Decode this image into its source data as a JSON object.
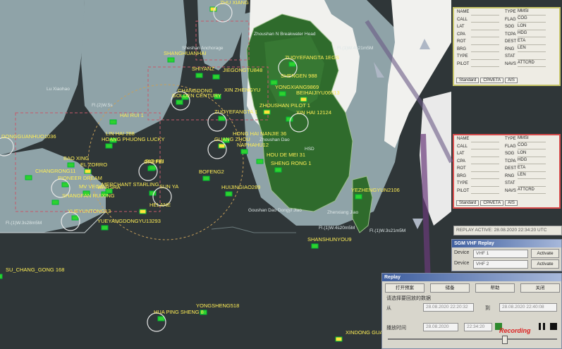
{
  "ships": [
    "ZHU XIANG",
    "SHANGHUANHAI",
    "SHIYANZ",
    "JIEGONGTU848",
    "CHANGDONG",
    "GOLDEN CENTURY",
    "XIN ZHENGYU",
    "ZHOUSHAN PILOT 1",
    "ZUOYEFANGTA 1",
    "HAI RUI 1",
    "LIN HAI 288",
    "HOANG PHUONG LUCKY",
    "DONGGUANHUO1036",
    "BAO XING",
    "EL ZORRO",
    "CHANGRONG11",
    "PIONEER DREAM",
    "MV VEGA",
    "SHANGFAN RUIXING",
    "WARSHA",
    "YUEYUNTONG13",
    "HELANE",
    "YUEYANGDONGYU13293",
    "GREFEI",
    "SUN YA",
    "BOFENG2",
    "HUIJINGIAO289",
    "HONG HAI NANJIE 36",
    "GUANG ZHOU",
    "NAPHAHU12",
    "HOU DE MEI 31",
    "SHENG RONG 1",
    "ZUOYEFANGTA 1EGS",
    "SHENGEN 988",
    "YONGXIANG9869",
    "BEIHAIJIYU06013",
    "XIN HAI 12124",
    "SHANSHUNYOU9",
    "YEZHENGYUN2106",
    "SU_CHANG_GONG 168",
    "HUA PING SHENG 8",
    "YONGSHENG518",
    "XINDONG GUAN",
    "MERCHANT STARLING",
    "PIG FEI"
  ],
  "places": [
    "Zhoushan N Breakwater Head",
    "Sheshan Anchorage",
    "Zhoushan Dao",
    "Goushan Dao Dongyi Jiao",
    "Zhenxiang Jiao",
    "HSD",
    "Lu Xiaohao"
  ],
  "positions": [
    "Fl.(2)W.5s",
    "Fl.(1)W.3s28m5M",
    "Fl.(1)W.4s20m5M",
    "Fl.(1)W.3s21m5M",
    "Fl.(1)W.4s21m5M"
  ],
  "info_panel_top": {
    "rows": [
      [
        "NAME",
        "TYPE",
        "MMSI"
      ],
      [
        "CALL",
        "FLAG",
        "COG"
      ],
      [
        "LAT",
        "SOG",
        "LON"
      ],
      [
        "CPA",
        "TCPA",
        "HDG"
      ],
      [
        "ROT",
        "DEST",
        "ETA"
      ],
      [
        "BRG",
        "RNG",
        "LEN"
      ],
      [
        "TYPE",
        "STAT",
        ""
      ],
      [
        "PILOT",
        "NAVS",
        "ATTCRD"
      ]
    ],
    "tabs": [
      "Standard",
      "CPA/ETA",
      "AIS"
    ]
  },
  "info_panel_mid": {
    "rows": [
      [
        "NAME",
        "TYPE",
        "MMSI"
      ],
      [
        "CALL",
        "FLAG",
        "COG"
      ],
      [
        "LAT",
        "SOG",
        "LON"
      ],
      [
        "CPA",
        "TCPA",
        "HDG"
      ],
      [
        "ROT",
        "DEST",
        "ETA"
      ],
      [
        "BRG",
        "RNG",
        "LEN"
      ],
      [
        "TYPE",
        "STAT",
        ""
      ],
      [
        "PILOT",
        "NAVS",
        "ATTCRD"
      ]
    ],
    "tabs": [
      "Standard",
      "CPA/ETA",
      "AIS"
    ]
  },
  "replay_banner": "REPLAY ACTIVE: 28.08.2020 22:34:20 UTC",
  "vhf": {
    "title": "SGM VHF Replay",
    "device_label": "Device",
    "device1": "VHF 1",
    "device2": "VHF 2",
    "activate": "Activate"
  },
  "replay": {
    "title": "Replay",
    "btn_open": "打开预案",
    "btn_save": "储备",
    "btn_help": "帮助",
    "btn_close": "关闭",
    "range_label": "请选择要回放的数据",
    "from_label": "从",
    "to_label": "到",
    "from_value": "28.08.2020 22:20:32",
    "to_value": "28.08.2020 22:40:08",
    "time_label": "播放时间",
    "date_value": "28.08.2020",
    "time_value": "22:34:20",
    "recording": "Recording"
  }
}
